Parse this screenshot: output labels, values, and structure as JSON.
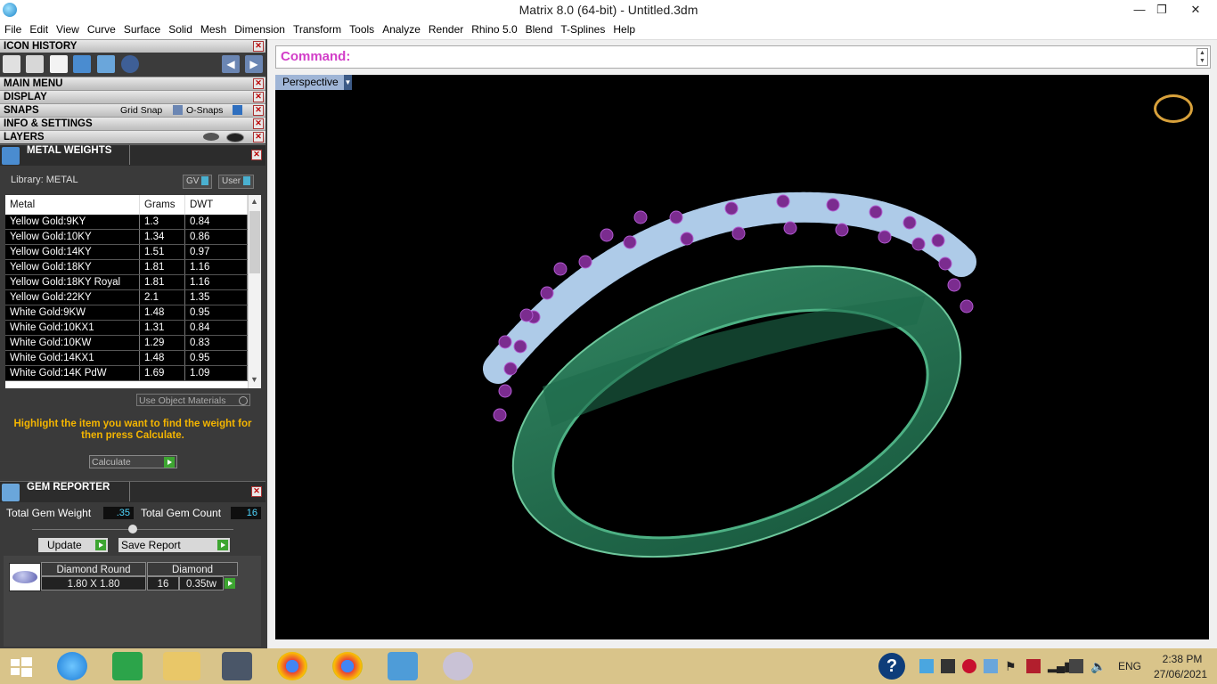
{
  "window": {
    "title": "Matrix 8.0 (64-bit) - Untitled.3dm",
    "minimize": "—",
    "restore": "❐",
    "close": "✕"
  },
  "menu": [
    "File",
    "Edit",
    "View",
    "Curve",
    "Surface",
    "Solid",
    "Mesh",
    "Dimension",
    "Transform",
    "Tools",
    "Analyze",
    "Render",
    "Rhino 5.0",
    "Blend",
    "T-Splines",
    "Help"
  ],
  "left_panel": {
    "sections": {
      "icon_history": "ICON HISTORY",
      "main_menu": "MAIN MENU",
      "display": "DISPLAY",
      "snaps": "SNAPS",
      "info_settings": "INFO & SETTINGS",
      "layers": "LAYERS"
    },
    "snaps": {
      "grid_snap": "Grid Snap",
      "o_snaps": "O-Snaps"
    },
    "icons": [
      "save-icon",
      "grid-snap-tool-icon",
      "clipboard-icon",
      "metal-weights-icon",
      "gem-report-icon",
      "run-icon"
    ],
    "metal_weights": {
      "title": "METAL WEIGHTS",
      "library": "Library: METAL",
      "gv_label": "GV",
      "user_label": "User",
      "columns": [
        "Metal",
        "Grams",
        "DWT"
      ],
      "rows": [
        [
          "Yellow Gold:9KY",
          "1.3",
          "0.84"
        ],
        [
          "Yellow Gold:10KY",
          "1.34",
          "0.86"
        ],
        [
          "Yellow Gold:14KY",
          "1.51",
          "0.97"
        ],
        [
          "Yellow Gold:18KY",
          "1.81",
          "1.16"
        ],
        [
          "Yellow Gold:18KY Royal",
          "1.81",
          "1.16"
        ],
        [
          "Yellow Gold:22KY",
          "2.1",
          "1.35"
        ],
        [
          "White Gold:9KW",
          "1.48",
          "0.95"
        ],
        [
          "White Gold:10KX1",
          "1.31",
          "0.84"
        ],
        [
          "White Gold:10KW",
          "1.29",
          "0.83"
        ],
        [
          "White Gold:14KX1",
          "1.48",
          "0.95"
        ],
        [
          "White Gold:14K PdW",
          "1.69",
          "1.09"
        ]
      ],
      "use_object_materials": "Use Object Materials",
      "hint": "Highlight the item you want to find the weight for then press Calculate.",
      "calculate": "Calculate"
    },
    "gem_reporter": {
      "title": "GEM REPORTER",
      "total_weight_label": "Total Gem Weight",
      "total_weight_value": ".35",
      "total_count_label": "Total Gem Count",
      "total_count_value": "16",
      "update": "Update",
      "save_report": "Save Report",
      "gem": {
        "shape_header": "Diamond Round",
        "type_header": "Diamond",
        "size": "1.80 X 1.80",
        "count": "16",
        "weight": "0.35tw"
      }
    }
  },
  "command": {
    "label": "Command:"
  },
  "viewport": {
    "name": "Perspective"
  },
  "taskbar": {
    "apps": [
      "windows-start-icon",
      "internet-explorer-icon",
      "store-icon",
      "file-explorer-icon",
      "matrix-app-icon",
      "chrome-icon",
      "chrome-icon-2",
      "vectorworks-icon",
      "paint-icon"
    ],
    "tray": {
      "lang": "ENG",
      "time": "2:38 PM",
      "date": "27/06/2021"
    }
  }
}
